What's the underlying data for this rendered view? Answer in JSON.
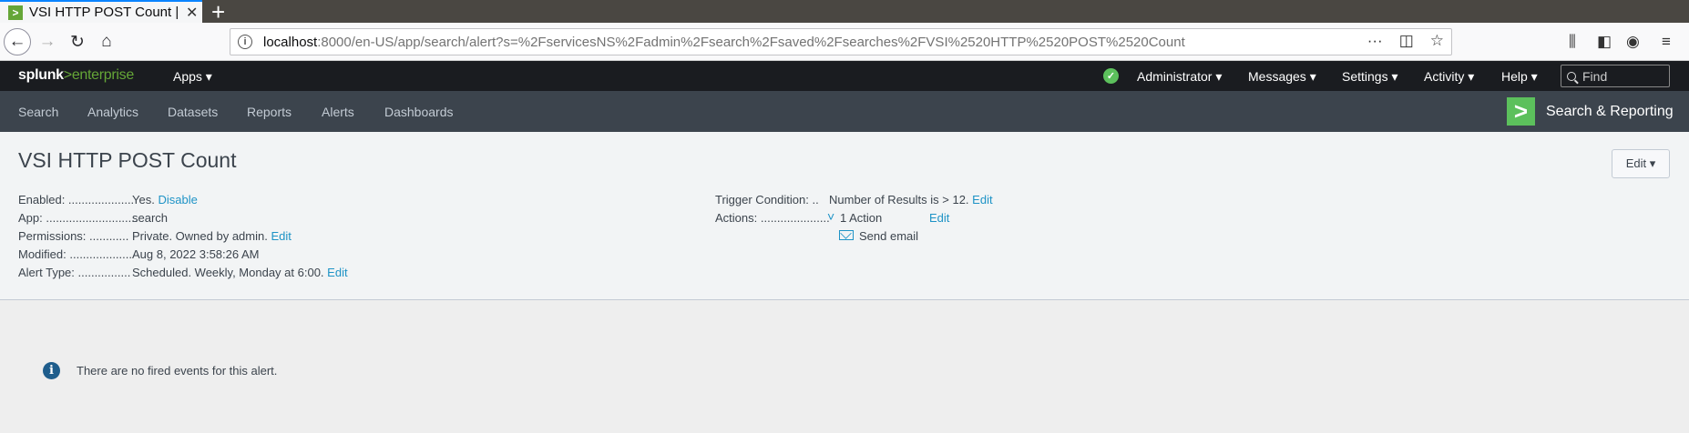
{
  "browser": {
    "tab_title": "VSI HTTP POST Count | Sp",
    "tab_favicon": ">",
    "tab_close": "✕",
    "new_tab": "+",
    "url_host": "localhost",
    "url_path": ":8000/en-US/app/search/alert?s=%2FservicesNS%2Fadmin%2Fsearch%2Fsaved%2Fsearches%2FVSI%2520HTTP%2520POST%2520Count"
  },
  "splunk_bar": {
    "logo_main": "splunk",
    "logo_gt": ">",
    "logo_product": "enterprise",
    "apps": "Apps ▾",
    "administrator": "Administrator ▾",
    "messages": "Messages ▾",
    "settings": "Settings ▾",
    "activity": "Activity ▾",
    "help": "Help ▾",
    "find_placeholder": "Find"
  },
  "app_nav": {
    "items": [
      "Search",
      "Analytics",
      "Datasets",
      "Reports",
      "Alerts",
      "Dashboards"
    ],
    "app_logo": ">",
    "app_title": "Search & Reporting"
  },
  "alert": {
    "title": "VSI HTTP POST Count",
    "edit_button": "Edit ▾",
    "enabled_label": "Enabled: ....................",
    "enabled_value": "Yes.",
    "enabled_action": "Disable",
    "app_label": "App: ............................",
    "app_value": "search",
    "permissions_label": "Permissions: ............",
    "permissions_value": "Private. Owned by admin.",
    "permissions_action": "Edit",
    "modified_label": "Modified: ...................",
    "modified_value": "Aug 8, 2022 3:58:26 AM",
    "alert_type_label": "Alert Type: ................",
    "alert_type_value": "Scheduled. Weekly, Monday at 6:00.",
    "alert_type_action": "Edit",
    "trigger_label": "Trigger Condition: ..",
    "trigger_value": "Number of Results is > 12.",
    "trigger_action": "Edit",
    "actions_label": "Actions: .....................",
    "actions_chevron": "˅",
    "actions_value": "1 Action",
    "actions_edit": "Edit",
    "send_email": "Send email"
  },
  "events": {
    "info_icon": "i",
    "empty_message": "There are no fired events for this alert."
  }
}
